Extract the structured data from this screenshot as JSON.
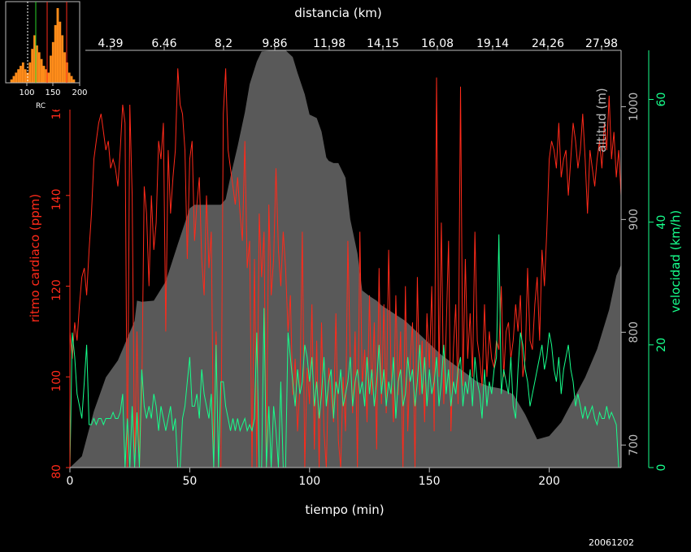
{
  "chart_data": {
    "type": "line",
    "top_axis_label": "distancia (km)",
    "top_ticks": [
      "4.39",
      "6.46",
      "8.2",
      "9.86",
      "11.98",
      "14.15",
      "16.08",
      "19.14",
      "24.26",
      "27.98"
    ],
    "x_label": "tiempo (min)",
    "x_ticks": [
      0,
      50,
      100,
      150,
      200
    ],
    "xlim": [
      0,
      230
    ],
    "hr_label": "ritmo cardiaco (ppm)",
    "hr_ticks": [
      80,
      100,
      120,
      140,
      160
    ],
    "hr_lim": [
      80,
      172
    ],
    "alt_label": "altitud (m)",
    "alt_ticks": [
      700,
      800,
      900,
      1000
    ],
    "alt_lim": [
      680,
      1050
    ],
    "vel_label": "velocidad (km/h)",
    "vel_ticks": [
      0,
      20,
      40,
      60
    ],
    "vel_lim": [
      0,
      68
    ],
    "altitude": {
      "t": [
        0,
        5,
        10,
        15,
        20,
        22,
        24,
        27,
        28,
        30,
        35,
        40,
        45,
        50,
        52,
        55,
        60,
        63,
        65,
        67,
        70,
        73,
        75,
        78,
        80,
        85,
        90,
        93,
        95,
        98,
        100,
        103,
        105,
        107,
        108,
        110,
        112,
        115,
        117,
        120,
        122,
        125,
        128,
        130,
        135,
        140,
        145,
        150,
        155,
        160,
        165,
        170,
        175,
        180,
        185,
        190,
        195,
        200,
        205,
        210,
        215,
        220,
        225,
        228,
        230
      ],
      "alt": [
        680,
        690,
        730,
        760,
        775,
        785,
        795,
        810,
        828,
        827,
        828,
        845,
        878,
        910,
        913,
        913,
        913,
        913,
        918,
        938,
        965,
        995,
        1020,
        1040,
        1049,
        1050,
        1050,
        1044,
        1030,
        1011,
        993,
        990,
        978,
        955,
        952,
        950,
        950,
        937,
        900,
        870,
        837,
        832,
        828,
        824,
        817,
        810,
        800,
        790,
        780,
        772,
        764,
        756,
        752,
        750,
        745,
        727,
        705,
        708,
        720,
        740,
        760,
        785,
        820,
        850,
        860
      ]
    },
    "series": [
      {
        "name": "ritmo cardiaco (ppm)",
        "color": "#ff2a1a",
        "axis": "hr",
        "x": [
          0,
          1,
          2,
          3,
          4,
          5,
          6,
          7,
          8,
          9,
          10,
          11,
          12,
          13,
          14,
          15,
          16,
          17,
          18,
          19,
          20,
          21,
          22,
          23,
          24,
          25,
          26,
          27,
          28,
          29,
          30,
          31,
          32,
          33,
          34,
          35,
          36,
          37,
          38,
          39,
          40,
          41,
          42,
          43,
          44,
          45,
          46,
          47,
          48,
          49,
          50,
          51,
          52,
          53,
          54,
          55,
          56,
          57,
          58,
          59,
          60,
          61,
          62,
          63,
          64,
          65,
          66,
          67,
          68,
          69,
          70,
          71,
          72,
          73,
          74,
          75,
          76,
          77,
          78,
          79,
          80,
          81,
          82,
          83,
          84,
          85,
          86,
          87,
          88,
          89,
          90,
          91,
          92,
          93,
          94,
          95,
          96,
          97,
          98,
          99,
          100,
          101,
          102,
          103,
          104,
          105,
          106,
          107,
          108,
          109,
          110,
          111,
          112,
          113,
          114,
          115,
          116,
          117,
          118,
          119,
          120,
          121,
          122,
          123,
          124,
          125,
          126,
          127,
          128,
          129,
          130,
          131,
          132,
          133,
          134,
          135,
          136,
          137,
          138,
          139,
          140,
          141,
          142,
          143,
          144,
          145,
          146,
          147,
          148,
          149,
          150,
          151,
          152,
          153,
          154,
          155,
          156,
          157,
          158,
          159,
          160,
          161,
          162,
          163,
          164,
          165,
          166,
          167,
          168,
          169,
          170,
          171,
          172,
          173,
          174,
          175,
          176,
          177,
          178,
          179,
          180,
          181,
          182,
          183,
          184,
          185,
          186,
          187,
          188,
          189,
          190,
          191,
          192,
          193,
          194,
          195,
          196,
          197,
          198,
          199,
          200,
          201,
          202,
          203,
          204,
          205,
          206,
          207,
          208,
          209,
          210,
          211,
          212,
          213,
          214,
          215,
          216,
          217,
          218,
          219,
          220,
          221,
          222,
          223,
          224,
          225,
          226,
          227,
          228,
          229,
          230
        ],
        "y": [
          110,
          104,
          112,
          108,
          116,
          122,
          124,
          118,
          128,
          136,
          148,
          152,
          156,
          158,
          154,
          150,
          152,
          146,
          148,
          146,
          142,
          150,
          160,
          156,
          80,
          160,
          140,
          80,
          110,
          80,
          96,
          142,
          136,
          120,
          140,
          128,
          134,
          152,
          148,
          156,
          110,
          150,
          136,
          144,
          150,
          168,
          160,
          158,
          150,
          126,
          148,
          152,
          130,
          138,
          144,
          126,
          118,
          140,
          124,
          132,
          80,
          110,
          80,
          80,
          158,
          168,
          150,
          146,
          142,
          138,
          144,
          136,
          130,
          152,
          124,
          130,
          80,
          126,
          80,
          136,
          122,
          132,
          80,
          138,
          118,
          126,
          146,
          128,
          120,
          132,
          124,
          110,
          118,
          96,
          104,
          88,
          98,
          132,
          80,
          102,
          94,
          116,
          84,
          108,
          80,
          112,
          88,
          80,
          102,
          96,
          90,
          114,
          86,
          80,
          100,
          88,
          130,
          104,
          92,
          110,
          80,
          132,
          98,
          106,
          90,
          118,
          96,
          112,
          84,
          124,
          94,
          116,
          92,
          128,
          102,
          90,
          118,
          96,
          110,
          80,
          120,
          88,
          104,
          112,
          80,
          122,
          96,
          108,
          90,
          114,
          102,
          120,
          88,
          166,
          100,
          134,
          94,
          110,
          130,
          88,
          106,
          116,
          94,
          164,
          98,
          126,
          104,
          114,
          100,
          132,
          108,
          104,
          98,
          116,
          100,
          110,
          104,
          102,
          108,
          106,
          120,
          100,
          110,
          112,
          104,
          108,
          116,
          110,
          118,
          100,
          104,
          124,
          108,
          106,
          116,
          122,
          108,
          128,
          120,
          132,
          148,
          152,
          150,
          146,
          156,
          144,
          148,
          150,
          140,
          148,
          156,
          152,
          146,
          150,
          158,
          148,
          136,
          150,
          146,
          142,
          148,
          152,
          146,
          156,
          150,
          162,
          148,
          154,
          144,
          150,
          140
        ]
      },
      {
        "name": "velocidad (km/h)",
        "color": "#17ff8c",
        "axis": "vel",
        "x": [
          0,
          1,
          2,
          3,
          4,
          5,
          6,
          7,
          8,
          9,
          10,
          11,
          12,
          13,
          14,
          15,
          16,
          17,
          18,
          19,
          20,
          21,
          22,
          23,
          24,
          25,
          26,
          27,
          28,
          29,
          30,
          31,
          32,
          33,
          34,
          35,
          36,
          37,
          38,
          39,
          40,
          41,
          42,
          43,
          44,
          45,
          46,
          47,
          48,
          49,
          50,
          51,
          52,
          53,
          54,
          55,
          56,
          57,
          58,
          59,
          60,
          61,
          62,
          63,
          64,
          65,
          66,
          67,
          68,
          69,
          70,
          71,
          72,
          73,
          74,
          75,
          76,
          77,
          78,
          79,
          80,
          81,
          82,
          83,
          84,
          85,
          86,
          87,
          88,
          89,
          90,
          91,
          92,
          93,
          94,
          95,
          96,
          97,
          98,
          99,
          100,
          101,
          102,
          103,
          104,
          105,
          106,
          107,
          108,
          109,
          110,
          111,
          112,
          113,
          114,
          115,
          116,
          117,
          118,
          119,
          120,
          121,
          122,
          123,
          124,
          125,
          126,
          127,
          128,
          129,
          130,
          131,
          132,
          133,
          134,
          135,
          136,
          137,
          138,
          139,
          140,
          141,
          142,
          143,
          144,
          145,
          146,
          147,
          148,
          149,
          150,
          151,
          152,
          153,
          154,
          155,
          156,
          157,
          158,
          159,
          160,
          161,
          162,
          163,
          164,
          165,
          166,
          167,
          168,
          169,
          170,
          171,
          172,
          173,
          174,
          175,
          176,
          177,
          178,
          179,
          180,
          181,
          182,
          183,
          184,
          185,
          186,
          187,
          188,
          189,
          190,
          191,
          192,
          193,
          194,
          195,
          196,
          197,
          198,
          199,
          200,
          201,
          202,
          203,
          204,
          205,
          206,
          207,
          208,
          209,
          210,
          211,
          212,
          213,
          214,
          215,
          216,
          217,
          218,
          219,
          220,
          221,
          222,
          223,
          224,
          225,
          226,
          227,
          228,
          229,
          230
        ],
        "y": [
          0,
          22,
          18,
          12,
          10,
          8,
          14,
          20,
          7,
          7,
          8,
          7,
          8,
          8,
          7,
          8,
          8,
          8,
          9,
          8,
          8,
          9,
          12,
          0,
          8,
          0,
          10,
          0,
          9,
          0,
          16,
          10,
          8,
          10,
          8,
          12,
          10,
          6,
          10,
          8,
          6,
          8,
          10,
          6,
          8,
          0,
          0,
          8,
          10,
          14,
          18,
          10,
          10,
          12,
          8,
          16,
          12,
          10,
          8,
          12,
          0,
          20,
          0,
          14,
          14,
          10,
          8,
          6,
          8,
          6,
          8,
          6,
          7,
          8,
          6,
          7,
          6,
          8,
          22,
          0,
          0,
          26,
          0,
          10,
          0,
          10,
          6,
          0,
          14,
          0,
          0,
          22,
          18,
          14,
          10,
          16,
          12,
          14,
          20,
          18,
          14,
          18,
          10,
          14,
          8,
          12,
          18,
          10,
          14,
          16,
          8,
          14,
          12,
          16,
          10,
          12,
          14,
          18,
          10,
          14,
          16,
          12,
          14,
          10,
          18,
          12,
          16,
          10,
          14,
          20,
          12,
          16,
          10,
          14,
          12,
          18,
          8,
          14,
          16,
          10,
          12,
          18,
          14,
          16,
          10,
          14,
          20,
          12,
          18,
          10,
          16,
          12,
          14,
          18,
          10,
          14,
          20,
          12,
          16,
          10,
          14,
          12,
          16,
          18,
          10,
          14,
          12,
          16,
          10,
          18,
          14,
          12,
          8,
          16,
          10,
          14,
          12,
          16,
          18,
          38,
          12,
          16,
          14,
          12,
          18,
          10,
          8,
          16,
          22,
          20,
          16,
          14,
          10,
          12,
          14,
          16,
          18,
          20,
          16,
          18,
          22,
          20,
          16,
          14,
          18,
          12,
          16,
          18,
          20,
          16,
          14,
          10,
          12,
          10,
          8,
          10,
          8,
          9,
          10,
          8,
          7,
          9,
          8,
          8,
          10,
          8,
          9,
          8,
          7,
          0,
          0
        ]
      }
    ]
  },
  "inset": {
    "x_ticks": [
      "100",
      "150",
      "200"
    ],
    "label": "RC",
    "bars": [
      0,
      0,
      1,
      2,
      3,
      4,
      5,
      6,
      4,
      3,
      6,
      10,
      14,
      11,
      9,
      7,
      5,
      4,
      3,
      8,
      12,
      17,
      22,
      18,
      14,
      9,
      6,
      3,
      2,
      1,
      0,
      0
    ]
  },
  "footer": "20061202"
}
